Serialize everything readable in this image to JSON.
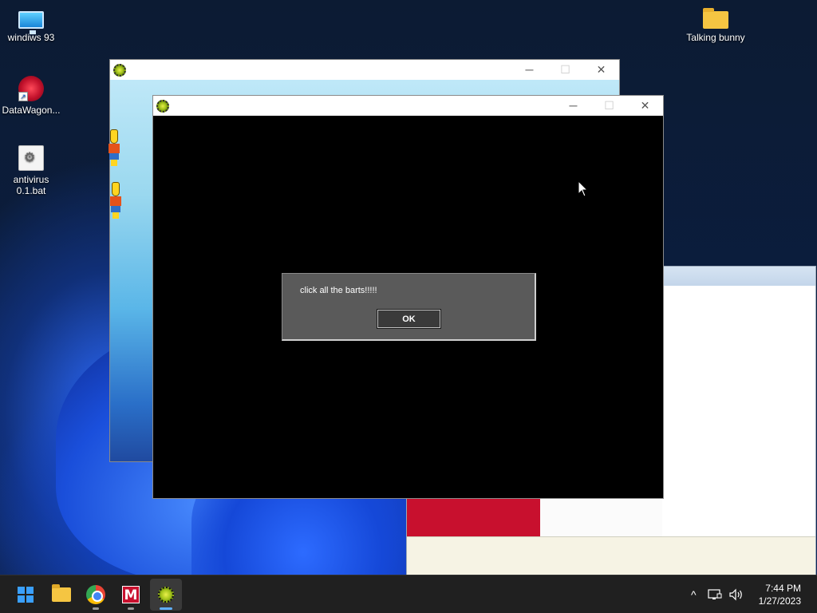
{
  "desktop": {
    "icons": [
      {
        "label": "windiws 93",
        "icon": "monitor-icon"
      },
      {
        "label": "DataWagon...",
        "icon": "web-shortcut-icon"
      },
      {
        "label": "antivirus 0.1.bat",
        "icon": "batch-file-icon"
      },
      {
        "label": "Talking bunny",
        "icon": "folder-icon"
      }
    ]
  },
  "windows": {
    "back": {
      "title": "",
      "controls": [
        "─",
        "☐",
        "✕"
      ]
    },
    "front": {
      "title": "",
      "controls": [
        "─",
        "☐",
        "✕"
      ]
    }
  },
  "dialog": {
    "message": "click all the barts!!!!!",
    "ok_label": "OK"
  },
  "taskbar": {
    "apps": [
      {
        "name": "Start",
        "icon": "windows-start-icon"
      },
      {
        "name": "File Explorer",
        "icon": "folder-icon"
      },
      {
        "name": "Google Chrome",
        "icon": "chrome-icon"
      },
      {
        "name": "McAfee",
        "icon": "mcafee-icon"
      },
      {
        "name": "Bart app",
        "icon": "gear-app-icon"
      }
    ],
    "tray": {
      "chevron": "^",
      "network": "network-icon",
      "volume": "volume-icon"
    },
    "clock": {
      "time": "7:44 PM",
      "date": "1/27/2023"
    }
  },
  "colors": {
    "taskbar": "#202020",
    "dialog": "#5a5a5a",
    "active_indicator": "#5fb0ff"
  }
}
